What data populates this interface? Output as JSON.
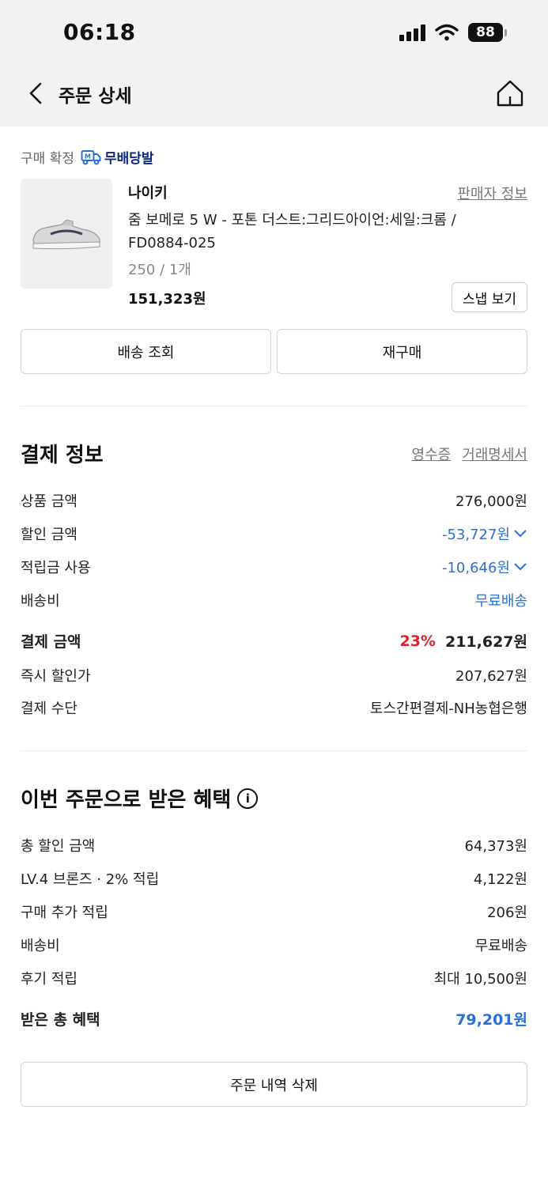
{
  "status_bar": {
    "time": "06:18",
    "battery": "88"
  },
  "header": {
    "title": "주문 상세"
  },
  "order": {
    "status_label": "구매 확정",
    "free_badge": "무배당발",
    "brand": "나이키",
    "seller_info": "판매자 정보",
    "product_name": "줌 보메로 5 W - 포톤 더스트:그리드아이언:세일:크롬 / FD0884-025",
    "option": "250 / 1개",
    "price": "151,323원",
    "snap_button": "스냅 보기",
    "track_button": "배송 조회",
    "reorder_button": "재구매"
  },
  "payment": {
    "title": "결제 정보",
    "receipt_link": "영수증",
    "statement_link": "거래명세서",
    "rows": [
      {
        "label": "상품 금액",
        "value": "276,000원"
      },
      {
        "label": "할인 금액",
        "value": "-53,727원"
      },
      {
        "label": "적립금 사용",
        "value": "-10,646원"
      },
      {
        "label": "배송비",
        "value": "무료배송"
      }
    ],
    "total": {
      "label": "결제 금액",
      "percent": "23%",
      "value": "211,627원"
    },
    "instant": {
      "label": "즉시 할인가",
      "value": "207,627원"
    },
    "method": {
      "label": "결제 수단",
      "value": "토스간편결제-NH농협은행"
    }
  },
  "benefits": {
    "title": "이번 주문으로 받은 혜택",
    "rows": [
      {
        "label": "총 할인 금액",
        "value": "64,373원"
      },
      {
        "label": "LV.4 브론즈 · 2% 적립",
        "value": "4,122원"
      },
      {
        "label": "구매 추가 적립",
        "value": "206원"
      },
      {
        "label": "배송비",
        "value": "무료배송"
      },
      {
        "label": "후기 적립",
        "value": "최대 10,500원"
      }
    ],
    "total": {
      "label": "받은 총 혜택",
      "value": "79,201원"
    }
  },
  "delete_button": "주문 내역 삭제",
  "colors": {
    "accent_blue": "#2b6fd6",
    "discount_red": "#e0202a",
    "badge_navy": "#0d2a7a"
  }
}
